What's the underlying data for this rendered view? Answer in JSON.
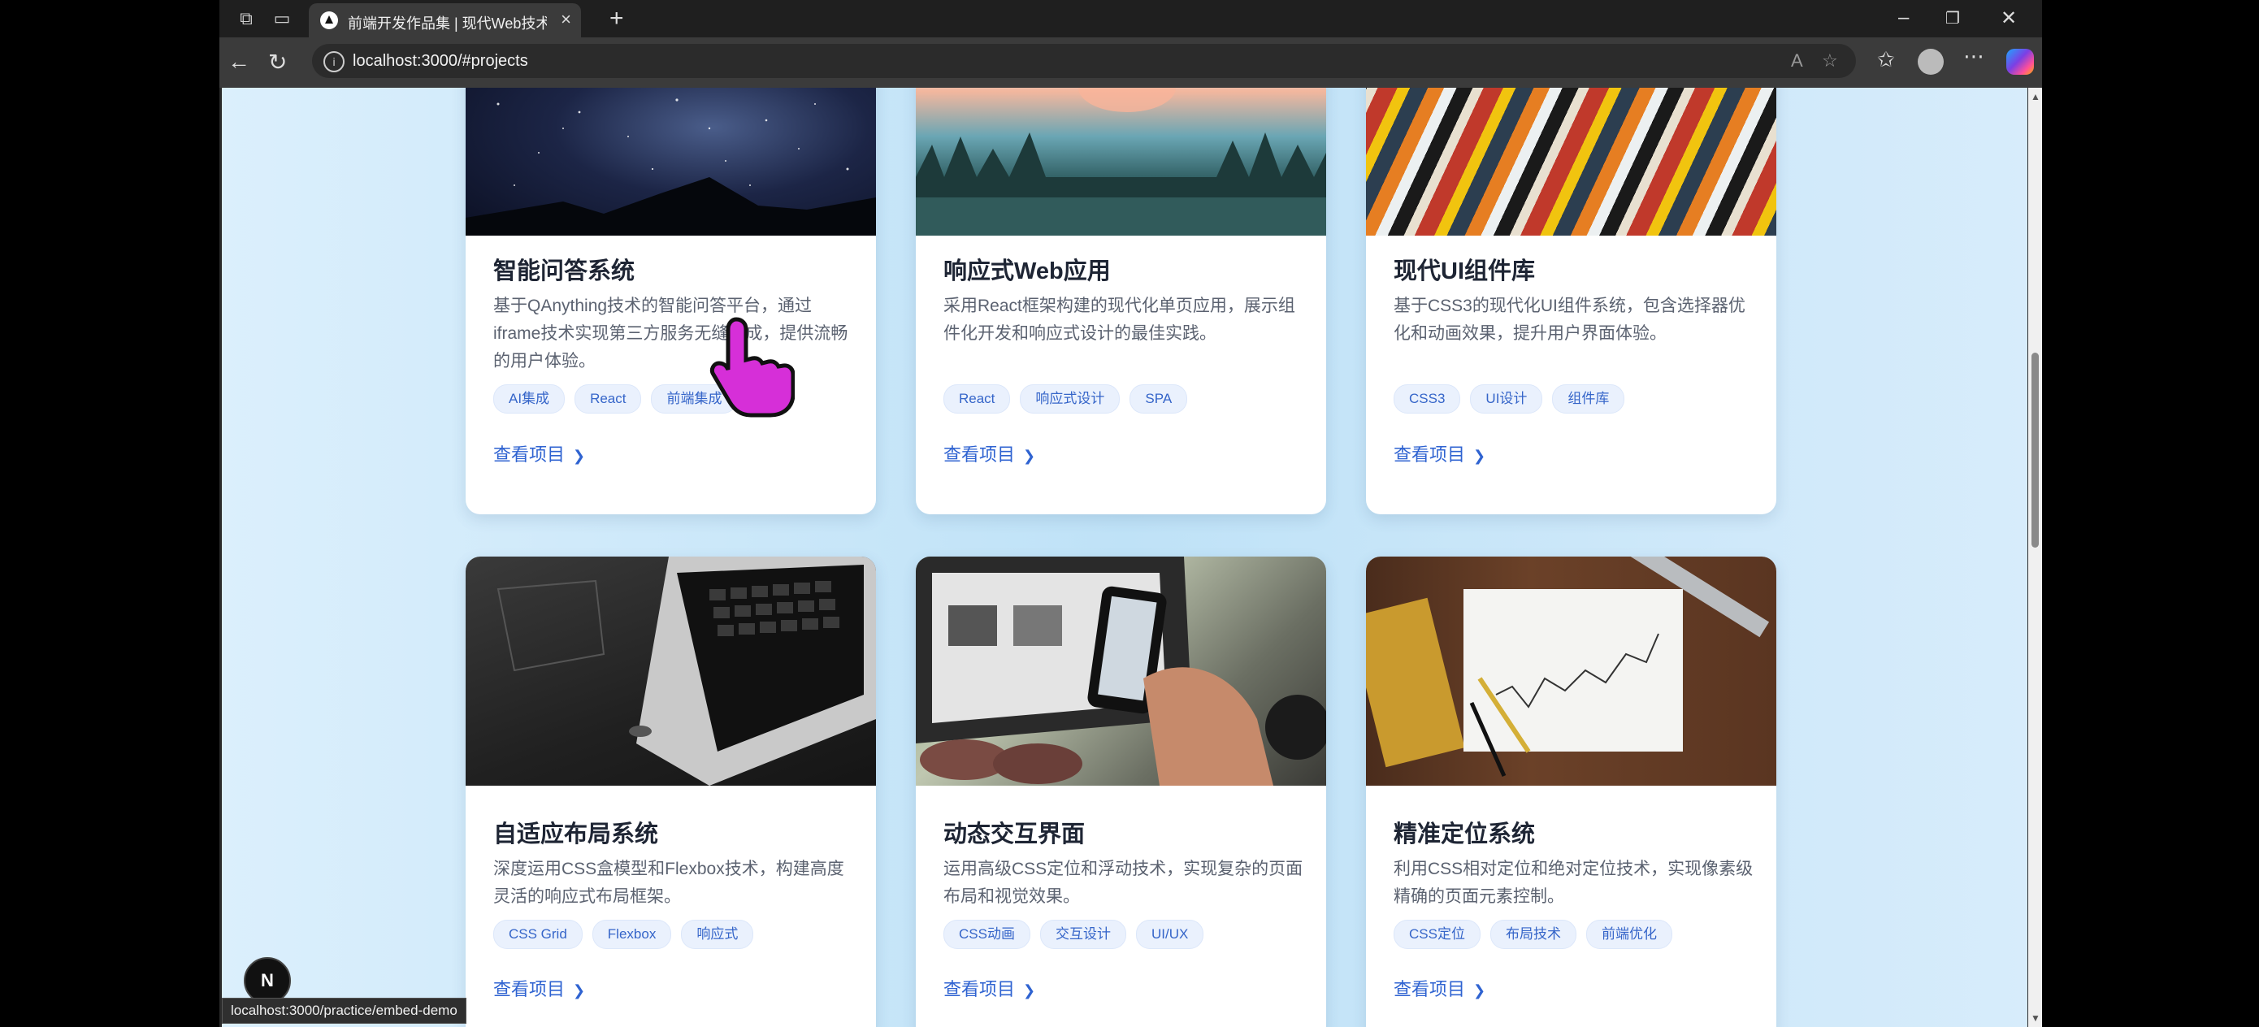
{
  "browser": {
    "tab_title": "前端开发作品集 | 现代Web技术展示",
    "url": "localhost:3000/#projects",
    "status_url": "localhost:3000/practice/embed-demo"
  },
  "projects": [
    {
      "title": "智能问答系统",
      "description": "基于QAnything技术的智能问答平台，通过iframe技术实现第三方服务无缝集成，提供流畅的用户体验。",
      "tags": [
        "AI集成",
        "React",
        "前端集成"
      ],
      "link": "查看项目",
      "image": "milky-way-night-sky"
    },
    {
      "title": "响应式Web应用",
      "description": "采用React框架构建的现代化单页应用，展示组件化开发和响应式设计的最佳实践。",
      "tags": [
        "React",
        "响应式设计",
        "SPA"
      ],
      "link": "查看项目",
      "image": "forest-lake-sunset"
    },
    {
      "title": "现代UI组件库",
      "description": "基于CSS3的现代化UI组件系统，包含选择器优化和动画效果，提升用户界面体验。",
      "tags": [
        "CSS3",
        "UI设计",
        "组件库"
      ],
      "link": "查看项目",
      "image": "colorful-book-spines"
    },
    {
      "title": "自适应布局系统",
      "description": "深度运用CSS盒模型和Flexbox技术，构建高度灵活的响应式布局框架。",
      "tags": [
        "CSS Grid",
        "Flexbox",
        "响应式"
      ],
      "link": "查看项目",
      "image": "laptop-dark-desk"
    },
    {
      "title": "动态交互界面",
      "description": "运用高级CSS定位和浮动技术，实现复杂的页面布局和视觉效果。",
      "tags": [
        "CSS动画",
        "交互设计",
        "UI/UX"
      ],
      "link": "查看项目",
      "image": "phone-and-laptop"
    },
    {
      "title": "精准定位系统",
      "description": "利用CSS相对定位和绝对定位技术，实现像素级精确的页面元素控制。",
      "tags": [
        "CSS定位",
        "布局技术",
        "前端优化"
      ],
      "link": "查看项目",
      "image": "chart-paper-ruler"
    }
  ],
  "overlays": {
    "next_badge": "N",
    "cursor": "hand-pointer-cursor"
  },
  "colors": {
    "accent": "#2f63d1",
    "tag_bg": "#eaf1fd",
    "page_bg": "#c6e5f8"
  }
}
